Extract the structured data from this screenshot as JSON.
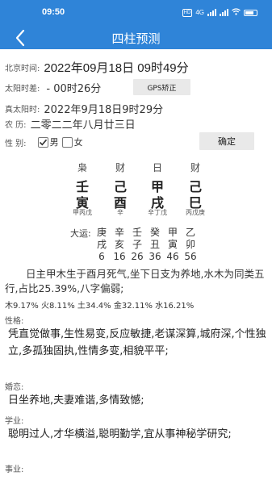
{
  "status_bar": {
    "time": "09:50",
    "hd_label": "HD",
    "network_label": "4G"
  },
  "header": {
    "title": "四柱预测"
  },
  "form": {
    "beijing_label": "北京时间:",
    "beijing_value": "2022年09月18日 09时49分",
    "solar_diff_label": "太阳时差:",
    "solar_diff_value": "- 00时26分",
    "gps_button": "GPS矫正",
    "true_solar_label": "真太阳时:",
    "true_solar_value": "2022年9月18日9时29分",
    "lunar_label": "农    历:",
    "lunar_value": "二零二二年八月廿三日",
    "gender_label": "性    别:",
    "male_label": "男",
    "female_label": "女",
    "male_checked": true,
    "female_checked": false,
    "confirm_button": "确定"
  },
  "pillars": [
    {
      "god": "枭",
      "stem": "壬",
      "branch": "寅",
      "hidden": "甲丙戊"
    },
    {
      "god": "财",
      "stem": "己",
      "branch": "酉",
      "hidden": "辛"
    },
    {
      "god": "日",
      "stem": "甲",
      "branch": "戌",
      "hidden": "辛丁戊"
    },
    {
      "god": "财",
      "stem": "己",
      "branch": "巳",
      "hidden": "丙戊庚"
    }
  ],
  "dayun": {
    "label": "大运:",
    "columns": [
      {
        "stem": "庚",
        "branch": "戌",
        "age": "6"
      },
      {
        "stem": "辛",
        "branch": "亥",
        "age": "16"
      },
      {
        "stem": "壬",
        "branch": "子",
        "age": "26"
      },
      {
        "stem": "癸",
        "branch": "丑",
        "age": "36"
      },
      {
        "stem": "甲",
        "branch": "寅",
        "age": "46"
      },
      {
        "stem": "乙",
        "branch": "卯",
        "age": "56"
      }
    ]
  },
  "analysis": {
    "summary": "日主甲木生于酉月死气,坐下日支为养地,水木为同类五行,占比25.39%,八字偏弱;",
    "elements": "木9.17% 火8.11% 土34.4% 金32.11% 水16.21%"
  },
  "sections": [
    {
      "label": "性格:",
      "text": "凭直觉做事,生性易变,反应敏捷,老谋深算,城府深,个性独立,多孤独固执,性情多变,相貌平平;"
    },
    {
      "label": "婚恋:",
      "text": "日坐养地,夫妻难谐,多情致憾;"
    },
    {
      "label": "学业:",
      "text": "聪明过人,才华横溢,聪明勤学,宜从事神秘学研究;"
    },
    {
      "label": "事业:",
      "text": ""
    }
  ]
}
